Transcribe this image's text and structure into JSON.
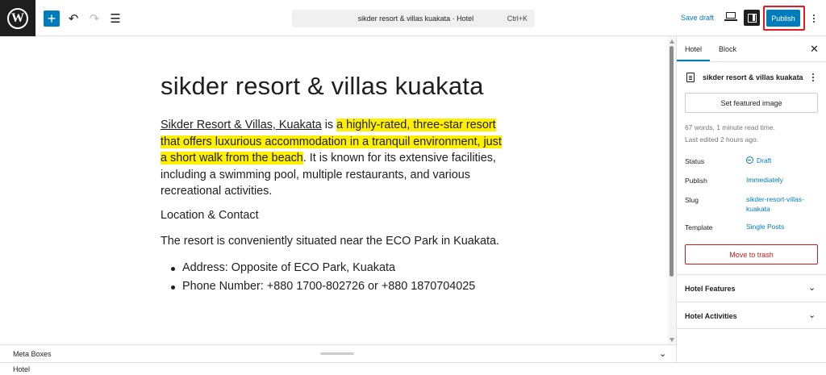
{
  "topbar": {
    "logo": "W",
    "add_icon": "+",
    "undo_icon": "↶",
    "redo_icon": "↷",
    "list_view_icon": "☰",
    "command_title": "sikder resort & villas kuakata · Hotel",
    "command_shortcut": "Ctrl+K",
    "save_draft": "Save draft",
    "publish": "Publish"
  },
  "editor": {
    "title": "sikder resort & villas kuakata",
    "para1": {
      "link": "Sikder Resort & Villas, Kuakata",
      "text_a": " is ",
      "highlight": "a highly-rated, three-star resort that offers luxurious accommodation in a tranquil environment, just a short walk from the beach",
      "text_b": ". It is known for its extensive facilities, including a swimming pool, multiple restaurants, and various recreational activities."
    },
    "heading": "Location & Contact",
    "para2": "The resort is conveniently situated near the ECO Park in Kuakata.",
    "list": [
      {
        "label": "Address",
        "value": ": Opposite of ECO Park, Kuakata"
      },
      {
        "label": "Phone Number",
        "value": ": +880 1700-802726 or +880 1870704025"
      }
    ]
  },
  "metabox": {
    "label": "Meta Boxes",
    "chevron": "⌄",
    "footer": "Hotel"
  },
  "sidebar": {
    "tabs": [
      "Hotel",
      "Block"
    ],
    "close": "✕",
    "post_name": "sikder resort & villas kuakata",
    "featured_image": "Set featured image",
    "words": "67 words, 1 minute read time.",
    "last_edited": "Last edited 2 hours ago.",
    "rows": {
      "status_label": "Status",
      "status_value": "Draft",
      "publish_label": "Publish",
      "publish_value": "Immediately",
      "slug_label": "Slug",
      "slug_value_1": "sikder-resort-villas-",
      "slug_value_2": "kuakata",
      "template_label": "Template",
      "template_value": "Single Posts"
    },
    "trash": "Move to trash",
    "panels": [
      "Hotel Features",
      "Hotel Activities"
    ],
    "chevron": "⌄"
  }
}
